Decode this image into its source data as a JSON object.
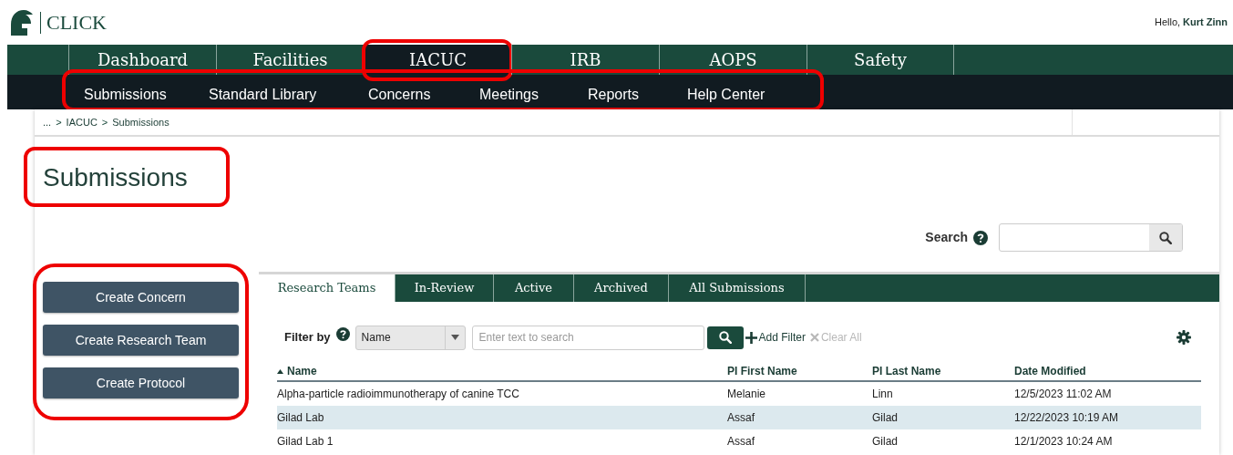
{
  "header": {
    "logo_text": "CLICK",
    "greeting": "Hello,",
    "user_name": "Kurt Zinn"
  },
  "main_nav": [
    {
      "label": "Dashboard",
      "selected": false,
      "outlined": false
    },
    {
      "label": "Facilities",
      "selected": false,
      "outlined": false
    },
    {
      "label": "IACUC",
      "selected": true,
      "outlined": true
    },
    {
      "label": "IRB",
      "selected": false,
      "outlined": false
    },
    {
      "label": "AOPS",
      "selected": false,
      "outlined": false
    },
    {
      "label": "Safety",
      "selected": false,
      "outlined": false
    }
  ],
  "sub_nav": {
    "outlined": true,
    "items": [
      "Submissions",
      "Standard Library",
      "Concerns",
      "Meetings",
      "Reports",
      "Help Center"
    ]
  },
  "breadcrumb": {
    "separator": ">",
    "items": [
      "...",
      "IACUC",
      "Submissions"
    ]
  },
  "page_title": {
    "text": "Submissions",
    "outlined": true
  },
  "search": {
    "label": "Search"
  },
  "actions": {
    "outlined": true,
    "buttons": [
      "Create Concern",
      "Create Research Team",
      "Create Protocol"
    ]
  },
  "tabs": [
    {
      "label": "Research Teams",
      "selected": true
    },
    {
      "label": "In-Review",
      "selected": false
    },
    {
      "label": "Active",
      "selected": false
    },
    {
      "label": "Archived",
      "selected": false
    },
    {
      "label": "All Submissions",
      "selected": false
    }
  ],
  "filter": {
    "label": "Filter by",
    "field": "Name",
    "placeholder": "Enter text to search",
    "add_filter": "Add Filter",
    "clear_all": "Clear All",
    "clear_all_disabled": true
  },
  "table": {
    "columns": [
      {
        "label": "Name",
        "sorted": true
      },
      {
        "label": "PI First Name",
        "sorted": false
      },
      {
        "label": "PI Last Name",
        "sorted": false
      },
      {
        "label": "Date Modified",
        "sorted": false
      }
    ],
    "rows": [
      {
        "cells": [
          "Alpha-particle radioimmunotherapy of canine TCC",
          "Melanie",
          "Linn",
          "12/5/2023 11:02 AM"
        ],
        "highlighted": false
      },
      {
        "cells": [
          "Gilad Lab",
          "Assaf",
          "Gilad",
          "12/22/2023 10:19 AM"
        ],
        "highlighted": true
      },
      {
        "cells": [
          "Gilad Lab 1",
          "Assaf",
          "Gilad",
          "12/1/2023 10:24 AM"
        ],
        "highlighted": false
      }
    ]
  }
}
